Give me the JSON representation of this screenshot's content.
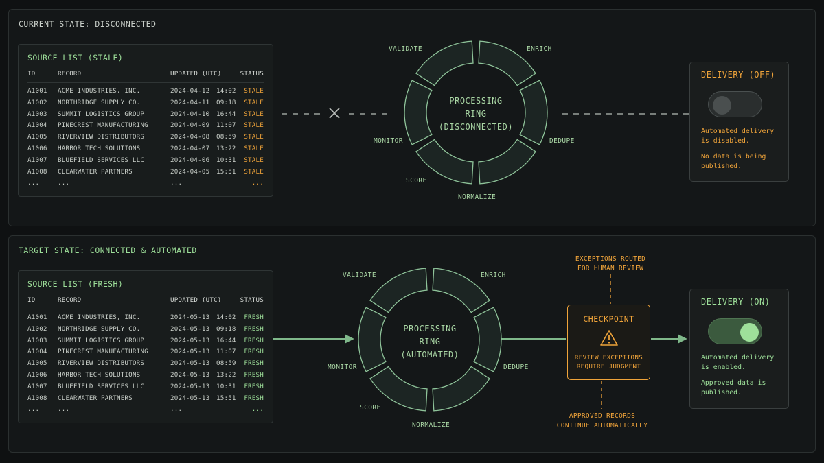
{
  "current": {
    "title": "CURRENT STATE: DISCONNECTED",
    "list": {
      "title": "SOURCE LIST (STALE)",
      "headers": {
        "id": "ID",
        "record": "RECORD",
        "updated": "UPDATED (UTC)",
        "status": "STATUS"
      },
      "rows": [
        {
          "id": "A1001",
          "record": "ACME INDUSTRIES, INC.",
          "date": "2024-04-12",
          "time": "14:02",
          "status": "STALE"
        },
        {
          "id": "A1002",
          "record": "NORTHRIDGE SUPPLY CO.",
          "date": "2024-04-11",
          "time": "09:18",
          "status": "STALE"
        },
        {
          "id": "A1003",
          "record": "SUMMIT LOGISTICS GROUP",
          "date": "2024-04-10",
          "time": "16:44",
          "status": "STALE"
        },
        {
          "id": "A1004",
          "record": "PINECREST MANUFACTURING",
          "date": "2024-04-09",
          "time": "11:07",
          "status": "STALE"
        },
        {
          "id": "A1005",
          "record": "RIVERVIEW DISTRIBUTORS",
          "date": "2024-04-08",
          "time": "08:59",
          "status": "STALE"
        },
        {
          "id": "A1006",
          "record": "HARBOR TECH SOLUTIONS",
          "date": "2024-04-07",
          "time": "13:22",
          "status": "STALE"
        },
        {
          "id": "A1007",
          "record": "BLUEFIELD SERVICES LLC",
          "date": "2024-04-06",
          "time": "10:31",
          "status": "STALE"
        },
        {
          "id": "A1008",
          "record": "CLEARWATER PARTNERS",
          "date": "2024-04-05",
          "time": "15:51",
          "status": "STALE"
        },
        {
          "id": "...",
          "record": "...",
          "date": "...",
          "time": "",
          "status": "..."
        }
      ]
    },
    "ring": {
      "center_line1": "PROCESSING",
      "center_line2": "RING",
      "center_line3": "(DISCONNECTED)",
      "stages": {
        "validate": "VALIDATE",
        "enrich": "ENRICH",
        "dedupe": "DEDUPE",
        "normalize": "NORMALIZE",
        "score": "SCORE",
        "monitor": "MONITOR"
      }
    },
    "delivery": {
      "title": "DELIVERY (OFF)",
      "text1": "Automated delivery is disabled.",
      "text2": "No data is being published."
    }
  },
  "target": {
    "title": "TARGET STATE: CONNECTED & AUTOMATED",
    "list": {
      "title": "SOURCE LIST (FRESH)",
      "headers": {
        "id": "ID",
        "record": "RECORD",
        "updated": "UPDATED (UTC)",
        "status": "STATUS"
      },
      "rows": [
        {
          "id": "A1001",
          "record": "ACME INDUSTRIES, INC.",
          "date": "2024-05-13",
          "time": "14:02",
          "status": "FRESH"
        },
        {
          "id": "A1002",
          "record": "NORTHRIDGE SUPPLY CO.",
          "date": "2024-05-13",
          "time": "09:18",
          "status": "FRESH"
        },
        {
          "id": "A1003",
          "record": "SUMMIT LOGISTICS GROUP",
          "date": "2024-05-13",
          "time": "16:44",
          "status": "FRESH"
        },
        {
          "id": "A1004",
          "record": "PINECREST MANUFACTURING",
          "date": "2024-05-13",
          "time": "11:07",
          "status": "FRESH"
        },
        {
          "id": "A1005",
          "record": "RIVERVIEW DISTRIBUTORS",
          "date": "2024-05-13",
          "time": "08:59",
          "status": "FRESH"
        },
        {
          "id": "A1006",
          "record": "HARBOR TECH SOLUTIONS",
          "date": "2024-05-13",
          "time": "13:22",
          "status": "FRESH"
        },
        {
          "id": "A1007",
          "record": "BLUEFIELD SERVICES LLC",
          "date": "2024-05-13",
          "time": "10:31",
          "status": "FRESH"
        },
        {
          "id": "A1008",
          "record": "CLEARWATER PARTNERS",
          "date": "2024-05-13",
          "time": "15:51",
          "status": "FRESH"
        },
        {
          "id": "...",
          "record": "...",
          "date": "...",
          "time": "",
          "status": "..."
        }
      ]
    },
    "ring": {
      "center_line1": "PROCESSING",
      "center_line2": "RING",
      "center_line3": "(AUTOMATED)",
      "stages": {
        "validate": "VALIDATE",
        "enrich": "ENRICH",
        "dedupe": "DEDUPE",
        "normalize": "NORMALIZE",
        "score": "SCORE",
        "monitor": "MONITOR"
      }
    },
    "checkpoint": {
      "title": "CHECKPOINT",
      "icon": "warning-icon",
      "line1": "REVIEW EXCEPTIONS",
      "line2": "REQUIRE JUDGMENT",
      "note_top_1": "EXCEPTIONS ROUTED",
      "note_top_2": "FOR HUMAN REVIEW",
      "note_bottom_1": "APPROVED RECORDS",
      "note_bottom_2": "CONTINUE AUTOMATICALLY"
    },
    "delivery": {
      "title": "DELIVERY (ON)",
      "text1": "Automated delivery is enabled.",
      "text2": "Approved data is published."
    }
  },
  "colors": {
    "green": "#9ee09a",
    "amber": "#f0a43a",
    "ring_fill": "#1c2523",
    "ring_stroke": "#8fc49a"
  }
}
